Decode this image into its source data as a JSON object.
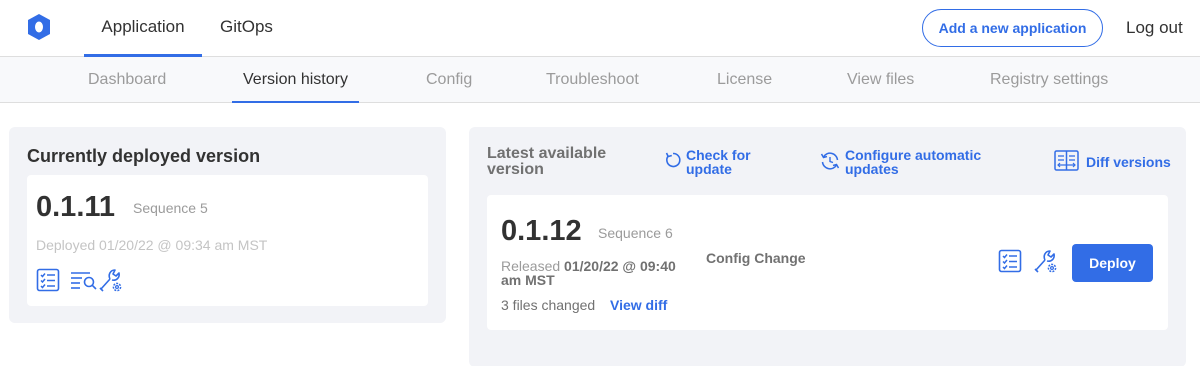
{
  "header": {
    "logo_icon": "kotsadm-logo-icon",
    "tabs": [
      "Application",
      "GitOps"
    ],
    "active_tab": "Application",
    "add_app_label": "Add a new application",
    "logout_label": "Log out"
  },
  "subnav": {
    "tabs": [
      "Dashboard",
      "Version history",
      "Config",
      "Troubleshoot",
      "License",
      "View files",
      "Registry settings"
    ],
    "active_tab": "Version history"
  },
  "current": {
    "title": "Currently deployed version",
    "version": "0.1.11",
    "sequence": "Sequence 5",
    "deployed": "Deployed 01/20/22 @ 09:34 am MST",
    "icons": [
      "release-notes-icon",
      "logs-icon",
      "edit-config-icon"
    ]
  },
  "latest": {
    "title": "Latest available version",
    "check_update": "Check for update",
    "configure_updates": "Configure automatic updates",
    "diff_versions": "Diff versions",
    "version": "0.1.12",
    "sequence": "Sequence 6",
    "released_prefix": "Released ",
    "released_date": "01/20/22 @ 09:40 am MST",
    "files_changed": "3 files changed",
    "view_diff": "View diff",
    "config_change": "Config Change",
    "deploy_label": "Deploy"
  },
  "colors": {
    "accent": "#326de6",
    "panel_bg": "#f2f3f7",
    "muted_text": "#9b9b9b"
  }
}
